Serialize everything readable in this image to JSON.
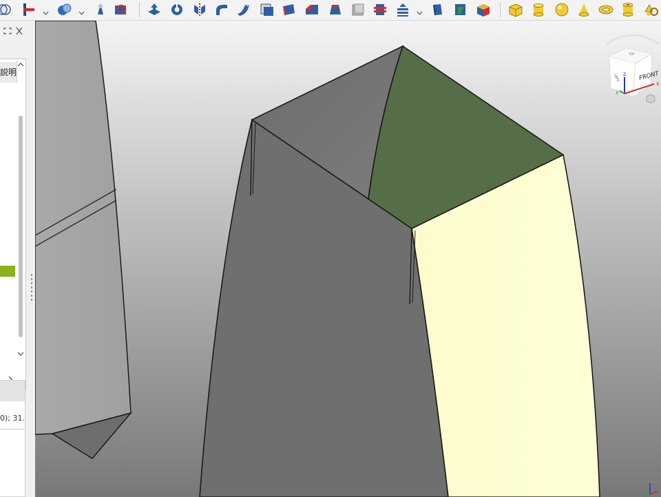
{
  "toolbar": {
    "icons": [
      "part-design-body-icon",
      "sketch-attachment-icon",
      "boolean-icon",
      "clone-icon",
      "refine-shape-icon",
      "extrude-icon",
      "revolve-icon",
      "mirror-icon",
      "fillet-icon",
      "sweep-icon",
      "offset-icon",
      "thickness-icon",
      "chamfer-icon",
      "draft-icon",
      "face-icon",
      "section-icon",
      "cross-sections-icon",
      "loft-icon",
      "ruled-surface-icon",
      "compound-icon",
      "box-icon",
      "cylinder-icon",
      "sphere-icon",
      "cone-icon",
      "torus-icon",
      "tube-icon",
      "primitives-icon"
    ]
  },
  "panel": {
    "column_header": "説明",
    "lower_row_text": "0); 31..."
  },
  "navcube": {
    "front_label": "FRONT",
    "left_label": "LEFT",
    "top_label": "TOP",
    "axis_x": "x",
    "axis_y": "y",
    "axis_z": "z"
  },
  "colors": {
    "background_top": "#f4f4f4",
    "background_bottom": "#7a7a7a",
    "face_green": "#556e47",
    "face_yellow": "#ffffd2",
    "face_gray": "#747474",
    "accent_green": "#8cb11a"
  }
}
